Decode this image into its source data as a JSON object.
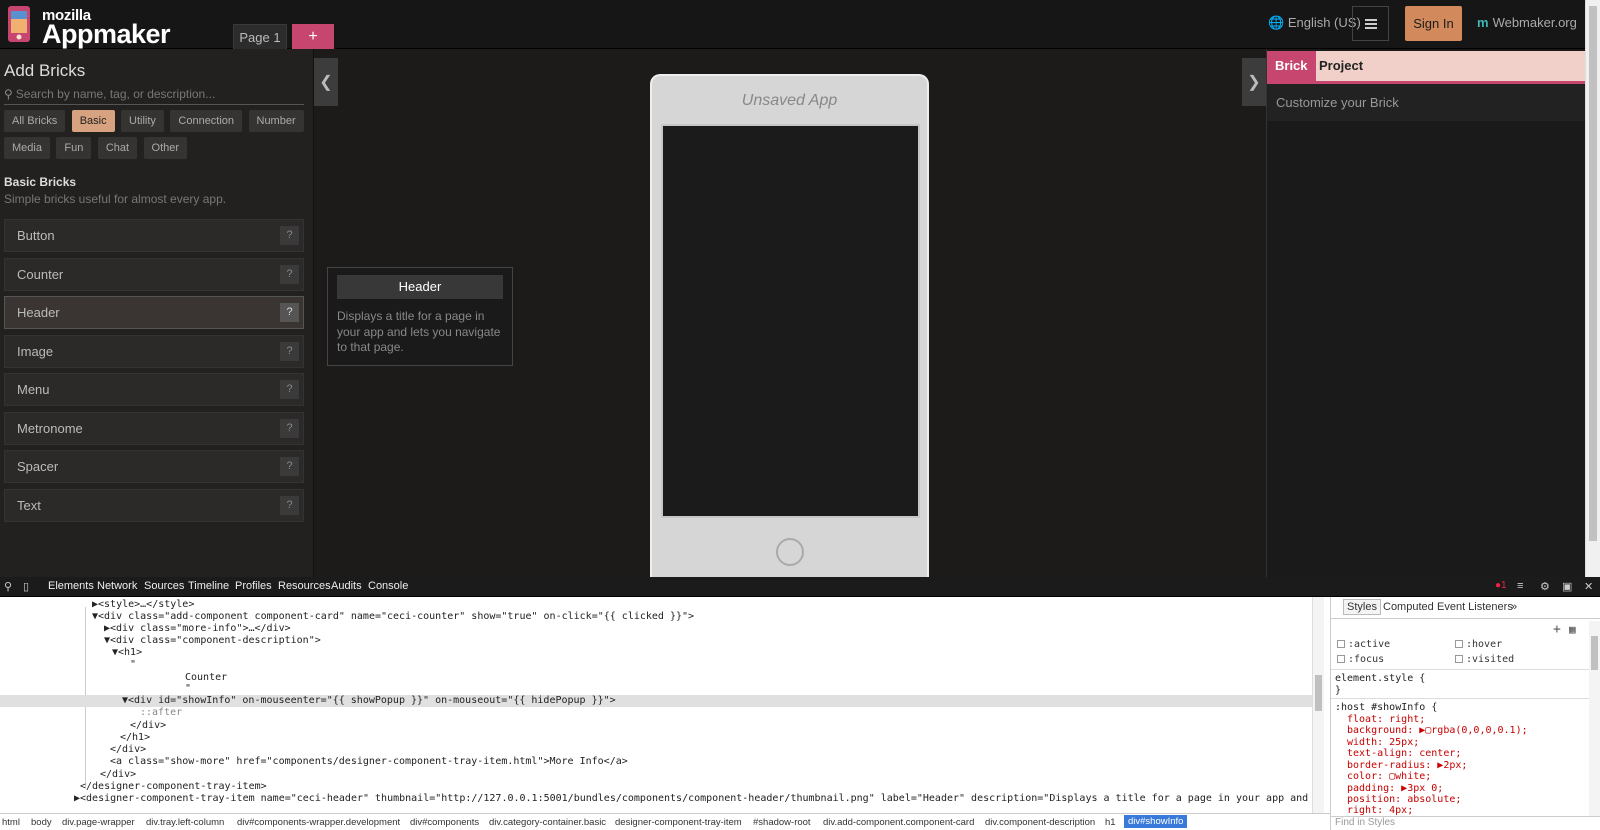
{
  "topbar": {
    "logo_mozilla": "mozilla",
    "logo_appmaker": "Appmaker",
    "page_tab": "Page 1",
    "add_page": "+",
    "language": "English (US)",
    "sign_in": "Sign In",
    "webmaker_m": "m",
    "webmaker": "Webmaker.org"
  },
  "left": {
    "title": "Add Bricks",
    "search_placeholder": "Search by name, tag, or description...",
    "categories": [
      "All Bricks",
      "Basic",
      "Utility",
      "Connection",
      "Number",
      "Media",
      "Fun",
      "Chat",
      "Other"
    ],
    "active_category": "Basic",
    "section_title": "Basic Bricks",
    "section_sub": "Simple bricks useful for almost every app.",
    "bricks": [
      "Button",
      "Counter",
      "Header",
      "Image",
      "Menu",
      "Metronome",
      "Spacer",
      "Text"
    ],
    "help_glyph": "?"
  },
  "tooltip": {
    "title": "Header",
    "description": "Displays a title for a page in your app and lets you navigate to that page."
  },
  "phone": {
    "title": "Unsaved App"
  },
  "right": {
    "tab_brick": "Brick",
    "tab_project": "Project",
    "customize": "Customize your Brick"
  },
  "devtools": {
    "tabs": [
      "Elements",
      "Network",
      "Sources",
      "Timeline",
      "Profiles",
      "Resources",
      "Audits",
      "Console"
    ],
    "error_count": "1",
    "dom_lines": [
      "▶<style>…</style>",
      "▼<div class=\"add-component component-card\" name=\"ceci-counter\" show=\"true\" on-click=\"{{ clicked }}\">",
      "▶<div class=\"more-info\">…</div>",
      "▼<div class=\"component-description\">",
      "▼<h1>",
      "\"",
      "Counter",
      "\"",
      "▼<div id=\"showInfo\" on-mouseenter=\"{{ showPopup }}\" on-mouseout=\"{{ hidePopup }}\">",
      "::after",
      "</div>",
      "</h1>",
      "</div>",
      "<a class=\"show-more\" href=\"components/designer-component-tray-item.html\">More Info</a>",
      "</div>",
      "</designer-component-tray-item>",
      "▶<designer-component-tray-item name=\"ceci-header\" thumbnail=\"http://127.0.0.1:5001/bundles/components/component-header/thumbnail.png\" label=\"Header\" description=\"Displays a title for a page in your app and lets you navigate"
    ],
    "styles_tabs": [
      "Styles",
      "Computed",
      "Event Listeners",
      "»"
    ],
    "pseudo": [
      ":active",
      ":hover",
      ":focus",
      ":visited"
    ],
    "element_style": "element.style {",
    "brace_close": "}",
    "rule_selector": ":host #showInfo {",
    "rule_props": [
      "float: right;",
      "background: ▶▢rgba(0,0,0,0.1);",
      "width: 25px;",
      "text-align: center;",
      "border-radius: ▶2px;",
      "color: ▢white;",
      "padding: ▶3px 0;",
      "position: absolute;",
      "right: 4px;"
    ],
    "find_styles": "Find in Styles",
    "crumbs": [
      "html",
      "body",
      "div.page-wrapper",
      "div.tray.left-column",
      "div#components-wrapper.development",
      "div#components",
      "div.category-container.basic",
      "designer-component-tray-item",
      "#shadow-root",
      "div.add-component.component-card",
      "div.component-description",
      "h1",
      "div#showInfo"
    ]
  },
  "colors": {
    "accent_pink": "#c7466f",
    "accent_tan": "#d6a27f",
    "signin": "#d28a5c",
    "webmaker_m": "#3fb6b2"
  }
}
